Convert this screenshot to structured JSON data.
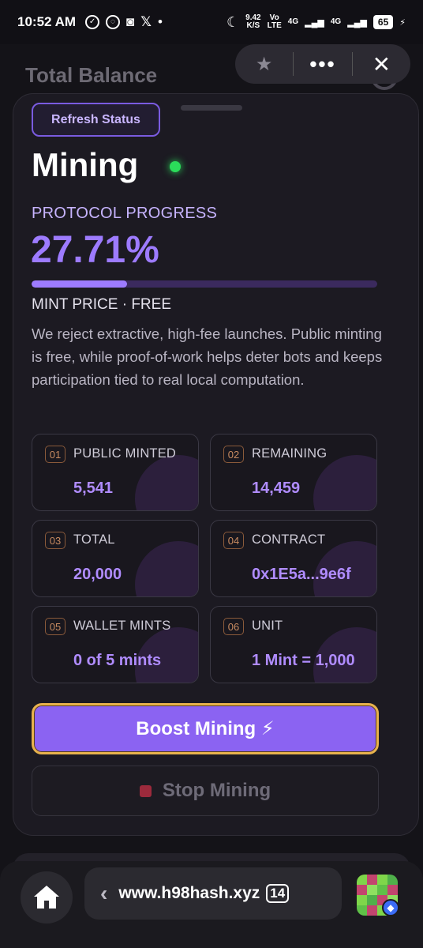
{
  "status_bar": {
    "time": "10:52 AM",
    "speed_top": "9.42",
    "speed_bottom": "K/S",
    "vo_top": "Vo",
    "vo_bottom": "LTE",
    "net1": "4G",
    "net2": "4G",
    "battery": "65"
  },
  "background": {
    "title": "Total Balance"
  },
  "topbar": {
    "star_icon": "star-icon",
    "more_icon": "more-dots-icon",
    "close_icon": "close-icon"
  },
  "sheet": {
    "refresh_label": "Refresh Status",
    "title": "Mining",
    "progress_label": "PROTOCOL PROGRESS",
    "progress_value": "27.71%",
    "progress_fraction": 0.2771,
    "mint_price": "MINT PRICE · FREE",
    "description": "We reject extractive, high-fee launches. Public minting is free, while proof-of-work helps deter bots and keeps participation tied to real local computation.",
    "stats": [
      {
        "num": "01",
        "label": "PUBLIC MINTED",
        "value": "5,541"
      },
      {
        "num": "02",
        "label": "REMAINING",
        "value": "14,459"
      },
      {
        "num": "03",
        "label": "TOTAL",
        "value": "20,000"
      },
      {
        "num": "04",
        "label": "CONTRACT",
        "value": "0x1E5a...9e6f"
      },
      {
        "num": "05",
        "label": "WALLET MINTS",
        "value": "0 of 5 mints"
      },
      {
        "num": "06",
        "label": "UNIT",
        "value": "1 Mint = 1,000"
      }
    ],
    "boost_label": "Boost Mining ⚡",
    "stop_label": "Stop Mining"
  },
  "browser": {
    "url": "www.h98hash.xyz",
    "tab_count": "14"
  },
  "colors": {
    "accent": "#9d7bff",
    "boost_bg": "#8b63f2",
    "boost_border": "#e7b24c",
    "live": "#2bdc5a"
  }
}
